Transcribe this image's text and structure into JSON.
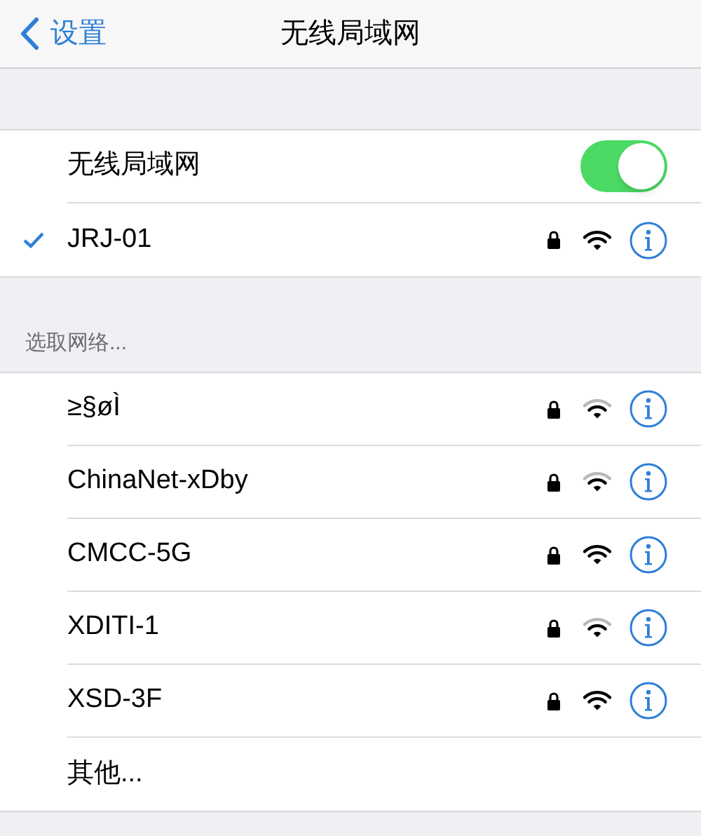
{
  "nav": {
    "back_label": "设置",
    "title": "无线局域网"
  },
  "wifi_toggle": {
    "label": "无线局域网",
    "on": true
  },
  "current_network": {
    "name": "JRJ-01",
    "connected": true,
    "locked": true,
    "kind": "strong"
  },
  "section_header": "选取网络...",
  "networks": [
    {
      "name": "≥§øÌ",
      "locked": true,
      "kind": "weak"
    },
    {
      "name": "ChinaNet-xDby",
      "locked": true,
      "kind": "weak"
    },
    {
      "name": "CMCC-5G",
      "locked": true,
      "kind": "strong"
    },
    {
      "name": "XDITI-1",
      "locked": true,
      "kind": "weak"
    },
    {
      "name": "XSD-3F",
      "locked": true,
      "kind": "strong"
    }
  ],
  "other_label": "其他..."
}
